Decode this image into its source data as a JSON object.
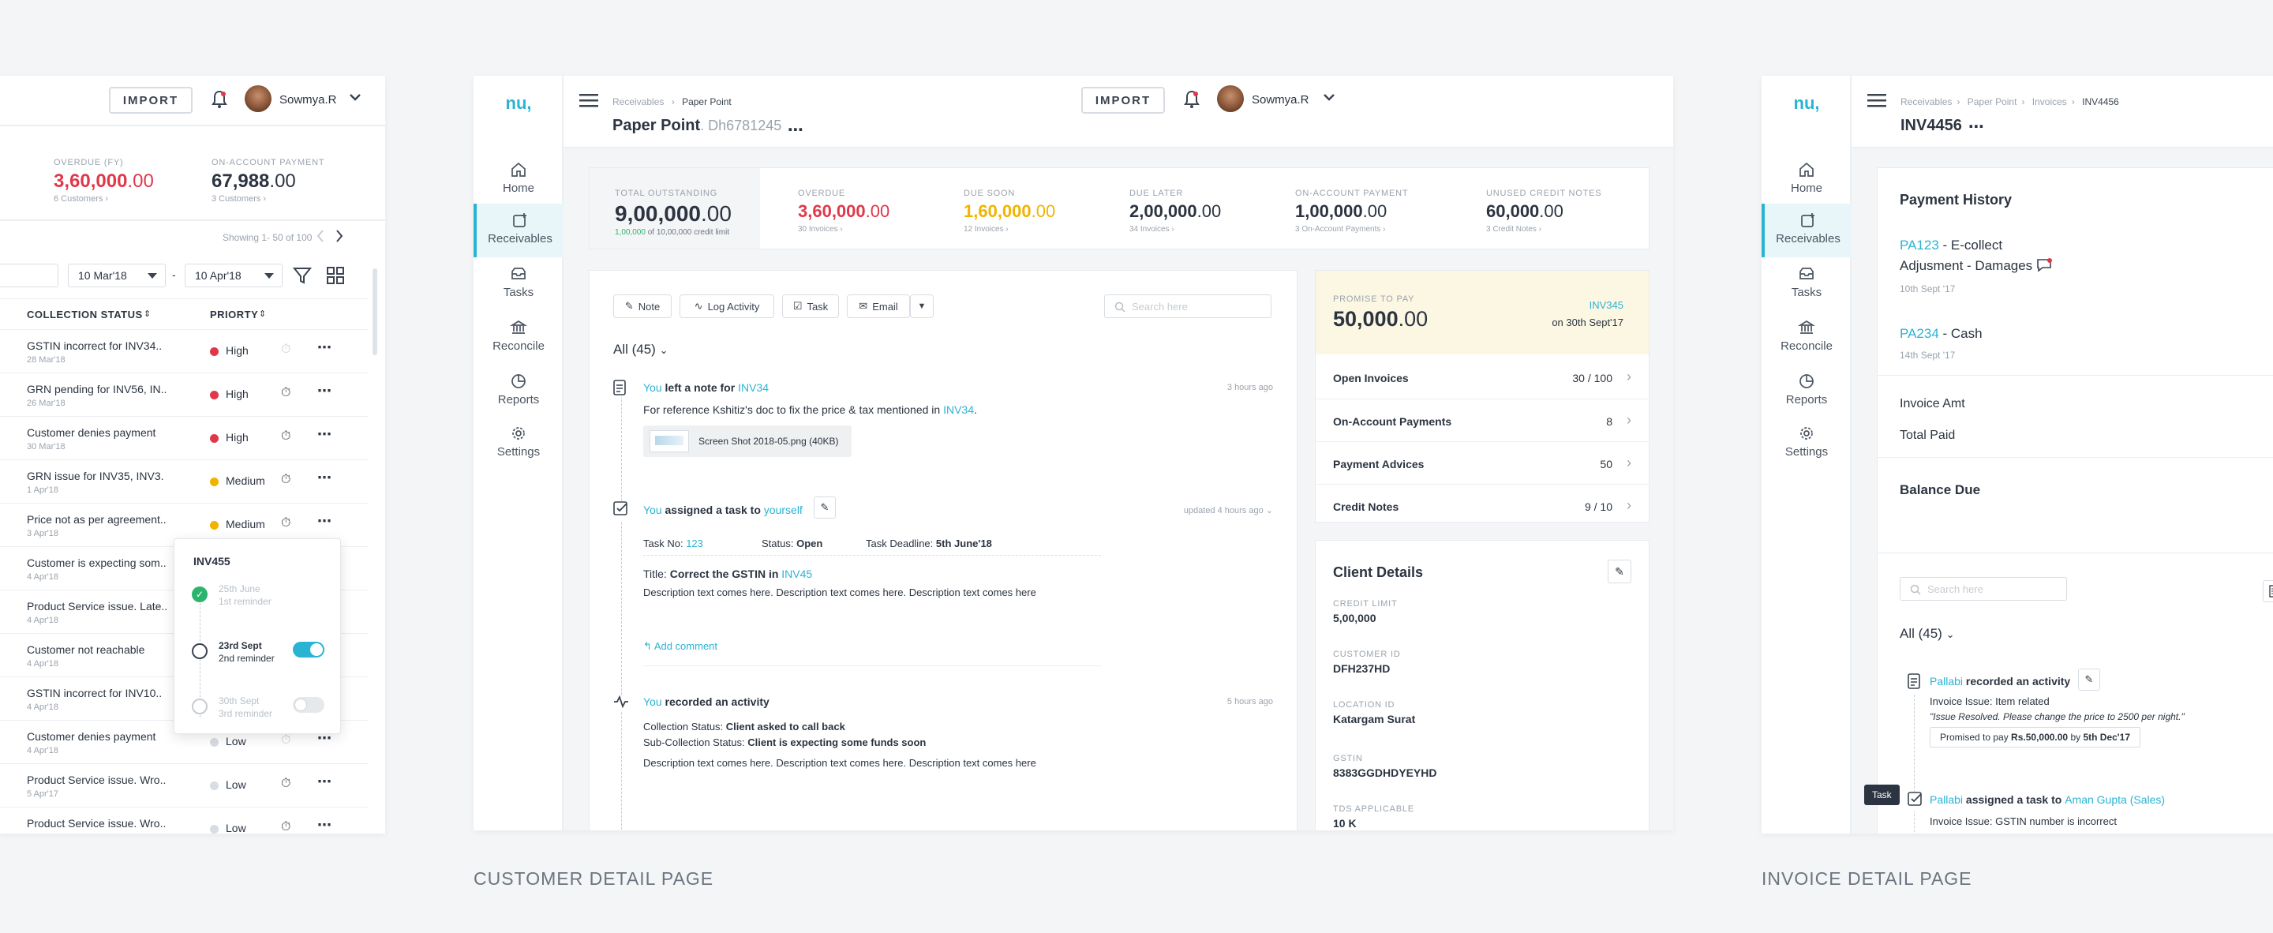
{
  "captions": {
    "customer": "CUSTOMER DETAIL PAGE",
    "invoice": "INVOICE DETAIL PAGE"
  },
  "header": {
    "import_label": "IMPORT",
    "user_name": "Sowmya.R"
  },
  "sidebar": {
    "logo": "nu,",
    "items": [
      {
        "label": "Home",
        "icon": "home-icon"
      },
      {
        "label": "Receivables",
        "icon": "receivables-icon"
      },
      {
        "label": "Tasks",
        "icon": "tasks-icon"
      },
      {
        "label": "Reconcile",
        "icon": "reconcile-icon"
      },
      {
        "label": "Reports",
        "icon": "reports-icon"
      },
      {
        "label": "Settings",
        "icon": "settings-icon"
      }
    ]
  },
  "left": {
    "overdue": {
      "label": "OVERDUE (FY)",
      "int": "3,60,000",
      "dec": ".00",
      "sub": "6 Customers"
    },
    "onaccount": {
      "label": "ON-ACCOUNT PAYMENT",
      "int": "67,988",
      "dec": ".00",
      "sub": "3 Customers"
    },
    "showing": "Showing 1- 50 of 100",
    "date_from": "10 Mar'18",
    "date_sep": "-",
    "date_to": "10 Apr'18",
    "col_status": "COLLECTION STATUS",
    "col_priority": "PRIORTY",
    "rows": [
      {
        "status": "GSTIN incorrect for INV34..",
        "date": "28 Mar'18",
        "priority": "High"
      },
      {
        "status": "GRN pending for INV56, IN..",
        "date": "26 Mar'18",
        "priority": "High"
      },
      {
        "status": "Customer denies payment",
        "date": "30 Mar'18",
        "priority": "High"
      },
      {
        "status": "GRN issue for INV35, INV3.",
        "date": "1 Apr'18",
        "priority": "Medium"
      },
      {
        "status": "Price not as per agreement..",
        "date": "3 Apr'18",
        "priority": "Medium"
      },
      {
        "status": "Customer is expecting som..",
        "date": "4 Apr'18",
        "priority": ""
      },
      {
        "status": "Product Service issue. Late..",
        "date": "4 Apr'18",
        "priority": ""
      },
      {
        "status": "Customer not reachable",
        "date": "4 Apr'18",
        "priority": ""
      },
      {
        "status": "GSTIN incorrect for INV10..",
        "date": "4 Apr'18",
        "priority": ""
      },
      {
        "status": "Customer denies payment",
        "date": "4 Apr'18",
        "priority": "Low"
      },
      {
        "status": "Product Service issue. Wro..",
        "date": "5 Apr'17",
        "priority": "Low"
      },
      {
        "status": "Product Service issue. Wro..",
        "date": "",
        "priority": "Low"
      }
    ],
    "popover": {
      "title": "INV455",
      "items": [
        {
          "date": "25th June",
          "desc": "1st reminder"
        },
        {
          "date": "23rd Sept",
          "desc": "2nd reminder"
        },
        {
          "date": "30th Sept",
          "desc": "3rd reminder"
        }
      ]
    }
  },
  "customer": {
    "breadcrumb": [
      "Receivables",
      "Paper Point"
    ],
    "title": "Paper Point",
    "id": ". Dh6781245",
    "stats": {
      "total": {
        "label": "TOTAL OUTSTANDING",
        "int": "9,00,000",
        "dec": ".00",
        "sub_green": "1,00,000",
        "sub_rest": " of 10,00,000 credit limit"
      },
      "items": [
        {
          "label": "OVERDUE",
          "int": "3,60,000",
          "dec": ".00",
          "sub": "30 Invoices",
          "color": "#e0384b"
        },
        {
          "label": "DUE SOON",
          "int": "1,60,000",
          "dec": ".00",
          "sub": "12 Invoices",
          "color": "#f0b400"
        },
        {
          "label": "DUE LATER",
          "int": "2,00,000",
          "dec": ".00",
          "sub": "34 Invoices",
          "color": "#2b3440"
        },
        {
          "label": "ON-ACCOUNT PAYMENT",
          "int": "1,00,000",
          "dec": ".00",
          "sub": "3 On-Account Payments",
          "color": "#2b3440"
        },
        {
          "label": "UNUSED CREDIT NOTES",
          "int": "60,000",
          "dec": ".00",
          "sub": "3 Credit Notes",
          "color": "#2b3440"
        }
      ]
    },
    "actions": [
      "Note",
      "Log Activity",
      "Task",
      "Email"
    ],
    "search_placeholder": "Search here",
    "filter": "All (45)",
    "feed": {
      "note": {
        "you": "You",
        "text": " left a note for ",
        "inv": "INV34",
        "time": "3 hours ago",
        "body": "For reference Kshitiz's doc to fix the price & tax mentioned in ",
        "body_inv": "INV34",
        "body_end": ".",
        "attachment": "Screen Shot 2018-05.png (40KB)"
      },
      "task": {
        "you": "You",
        "text": " assigned a task to ",
        "who": "yourself",
        "time": "updated 4 hours ago",
        "no_label": "Task No:",
        "no": "123",
        "status_label": "Status:",
        "status": "Open",
        "deadline_label": "Task Deadline:",
        "deadline": "5th June'18",
        "title_label": "Title:",
        "title": "Correct the GSTIN in",
        "title_inv": "INV45",
        "desc": "Description text comes here. Description text comes here. Description text comes here",
        "add_comment": "Add comment"
      },
      "activity": {
        "you": "You",
        "text": " recorded an activity",
        "time": "5 hours ago",
        "cs_label": "Collection Status:",
        "cs": "Client asked to call back",
        "scs_label": "Sub-Collection Status:",
        "scs": "Client is expecting some funds soon",
        "desc": "Description text comes here. Description text comes here. Description text comes here"
      }
    },
    "promise": {
      "label": "PROMISE TO PAY",
      "int": "50,000",
      "dec": ".00",
      "inv": "INV345",
      "on": "on 30th Sept'17"
    },
    "summary": [
      {
        "label": "Open Invoices",
        "value": "30 / 100"
      },
      {
        "label": "On-Account Payments",
        "value": "8"
      },
      {
        "label": "Payment Advices",
        "value": "50"
      },
      {
        "label": "Credit Notes",
        "value": "9 / 10"
      }
    ],
    "client": {
      "title": "Client Details",
      "fields": [
        {
          "label": "CREDIT LIMIT",
          "value": "5,00,000"
        },
        {
          "label": "CUSTOMER ID",
          "value": "DFH237HD"
        },
        {
          "label": "LOCATION ID",
          "value": "Katargam Surat"
        },
        {
          "label": "GSTIN",
          "value": "8383GGDHDYEYHD"
        },
        {
          "label": "TDS APPLICABLE",
          "value": "10 K"
        }
      ]
    }
  },
  "invoice": {
    "breadcrumb": [
      "Receivables",
      "Paper Point",
      "Invoices",
      "INV4456"
    ],
    "title": "INV4456",
    "history_title": "Payment History",
    "history": [
      {
        "id": "PA123",
        "line1": " - E-collect",
        "line2": "Adjusment - Damages",
        "date": "10th Sept '17"
      },
      {
        "id": "PA234",
        "line1": " - Cash",
        "line2": "",
        "date": "14th Sept '17"
      }
    ],
    "invoice_amt": "Invoice Amt",
    "total_paid": "Total Paid",
    "balance_due": "Balance Due",
    "search_placeholder": "Search here",
    "filter": "All (45)",
    "feed1": {
      "who": "Pallabi",
      "text": " recorded an activity",
      "issue": "Invoice Issue: Item related",
      "quote": "\"Issue Resolved. Please change the price to 2500 per night.\"",
      "promise_pre": "Promised to pay ",
      "promise_amt": "Rs.50,000.00",
      "promise_mid": " by ",
      "promise_date": "5th Dec'17"
    },
    "feed2": {
      "who": "Pallabi",
      "text": " assigned a task to ",
      "target": "Aman Gupta (Sales)",
      "issue": "Invoice Issue: GSTIN number is incorrect"
    },
    "tooltip": "Task"
  }
}
